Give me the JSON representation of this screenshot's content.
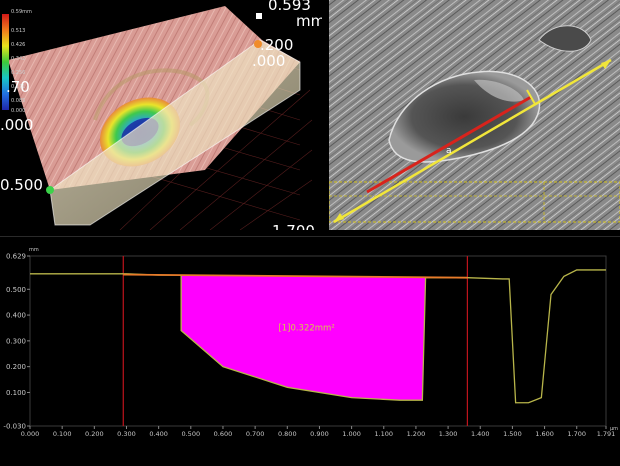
{
  "view3d": {
    "unit": "mm",
    "top_value": "0.593",
    "right_values": [
      ".200",
      ".000"
    ],
    "left_values": [
      ".70",
      ".000"
    ],
    "axis_value": "0.500",
    "bottom_value": "1.700",
    "colorbar": {
      "max_label": "0.59mm",
      "tick_labels": [
        "0.513",
        "0.426",
        "0.342",
        "0.256",
        "0.171",
        "0.085",
        "0.000"
      ]
    }
  },
  "micro": {
    "marker": "a"
  },
  "profile": {
    "unit": "mm",
    "x_unit": "μm",
    "area_label": "[1]0.322mm²",
    "colors": {
      "fill": "#ff00ff",
      "trace": "#b8b54a",
      "cursor": "#c0141c",
      "segment": "#e87b2a",
      "area_text": "#d6c84a"
    }
  },
  "chart_data": {
    "type": "line",
    "x": [
      0.0,
      0.1,
      0.2,
      0.3,
      0.4,
      0.47,
      0.47,
      0.6,
      0.8,
      1.0,
      1.15,
      1.22,
      1.23,
      1.36,
      1.47,
      1.49,
      1.51,
      1.55,
      1.59,
      1.62,
      1.66,
      1.7,
      1.791
    ],
    "series": [
      {
        "values": [
          0.56,
          0.56,
          0.56,
          0.56,
          0.555,
          0.555,
          0.34,
          0.2,
          0.12,
          0.08,
          0.07,
          0.07,
          0.545,
          0.545,
          0.54,
          0.54,
          0.06,
          0.06,
          0.08,
          0.48,
          0.55,
          0.575,
          0.575
        ]
      }
    ],
    "fill_region": {
      "x_range": [
        0.47,
        1.23
      ],
      "area": "0.322mm²"
    },
    "cursors_x": [
      0.29,
      1.36
    ],
    "xlim": [
      0.0,
      1.791
    ],
    "ylim": [
      -0.03,
      0.629
    ],
    "x_ticks": [
      "0.000",
      "0.100",
      "0.200",
      "0.300",
      "0.400",
      "0.500",
      "0.600",
      "0.700",
      "0.800",
      "0.900",
      "1.000",
      "1.100",
      "1.200",
      "1.300",
      "1.400",
      "1.500",
      "1.600",
      "1.700",
      "1.791"
    ],
    "y_ticks": [
      "0.629",
      "0.500",
      "0.400",
      "0.300",
      "0.200",
      "0.100",
      "-0.030"
    ],
    "grid": false
  }
}
